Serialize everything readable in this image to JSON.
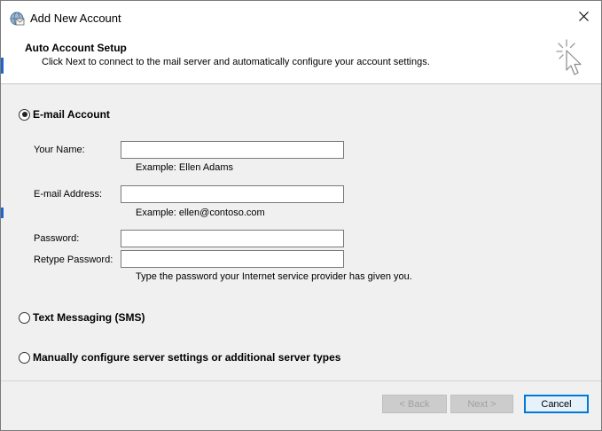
{
  "window": {
    "title": "Add New Account"
  },
  "header": {
    "title": "Auto Account Setup",
    "subtitle": "Click Next to connect to the mail server and automatically configure your account settings."
  },
  "options": {
    "email_account": {
      "label": "E-mail Account",
      "selected": true
    },
    "sms": {
      "label": "Text Messaging (SMS)",
      "selected": false
    },
    "manual": {
      "label": "Manually configure server settings or additional server types",
      "selected": false
    }
  },
  "form": {
    "your_name": {
      "label": "Your Name:",
      "value": "",
      "hint": "Example: Ellen Adams"
    },
    "email": {
      "label": "E-mail Address:",
      "value": "",
      "hint": "Example: ellen@contoso.com"
    },
    "password": {
      "label": "Password:",
      "value": ""
    },
    "retype_password": {
      "label": "Retype Password:",
      "value": "",
      "hint": "Type the password your Internet service provider has given you."
    }
  },
  "buttons": {
    "back": "< Back",
    "next": "Next >",
    "cancel": "Cancel"
  },
  "icons": {
    "title": "mail-account-icon",
    "close": "close-icon",
    "wizard": "cursor-sparkle-icon"
  }
}
